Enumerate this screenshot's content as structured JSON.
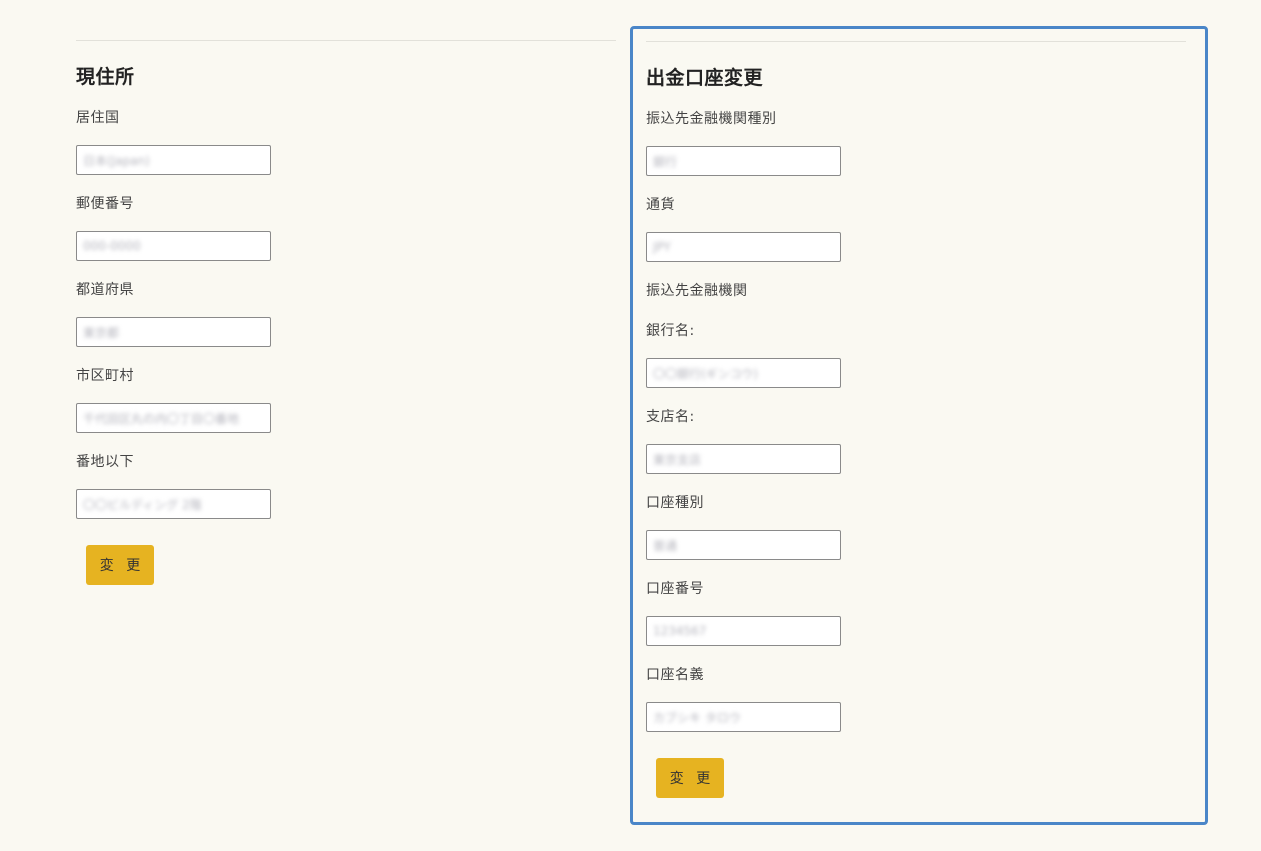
{
  "address": {
    "title": "現住所",
    "fields": [
      {
        "label": "居住国",
        "value": "日本(Japan)"
      },
      {
        "label": "郵便番号",
        "value": "000-0000"
      },
      {
        "label": "都道府県",
        "value": "東京都"
      },
      {
        "label": "市区町村",
        "value": "千代田区丸の内〇丁目〇番地"
      },
      {
        "label": "番地以下",
        "value": "〇〇ビルディング 2階"
      }
    ],
    "submit_label": "変 更"
  },
  "withdrawal": {
    "title": "出金口座変更",
    "fields": [
      {
        "label": "振込先金融機関種別",
        "value": "銀行"
      },
      {
        "label": "通貨",
        "value": "JPY"
      },
      {
        "label": "振込先金融機関",
        "value": null
      },
      {
        "label": "銀行名:",
        "value": "〇〇銀行(ギンコウ)"
      },
      {
        "label": "支店名:",
        "value": "東京支店"
      },
      {
        "label": "口座種別",
        "value": "普通"
      },
      {
        "label": "口座番号",
        "value": "1234567"
      },
      {
        "label": "口座名義",
        "value": "カブシキ タロウ"
      }
    ],
    "submit_label": "変 更"
  }
}
